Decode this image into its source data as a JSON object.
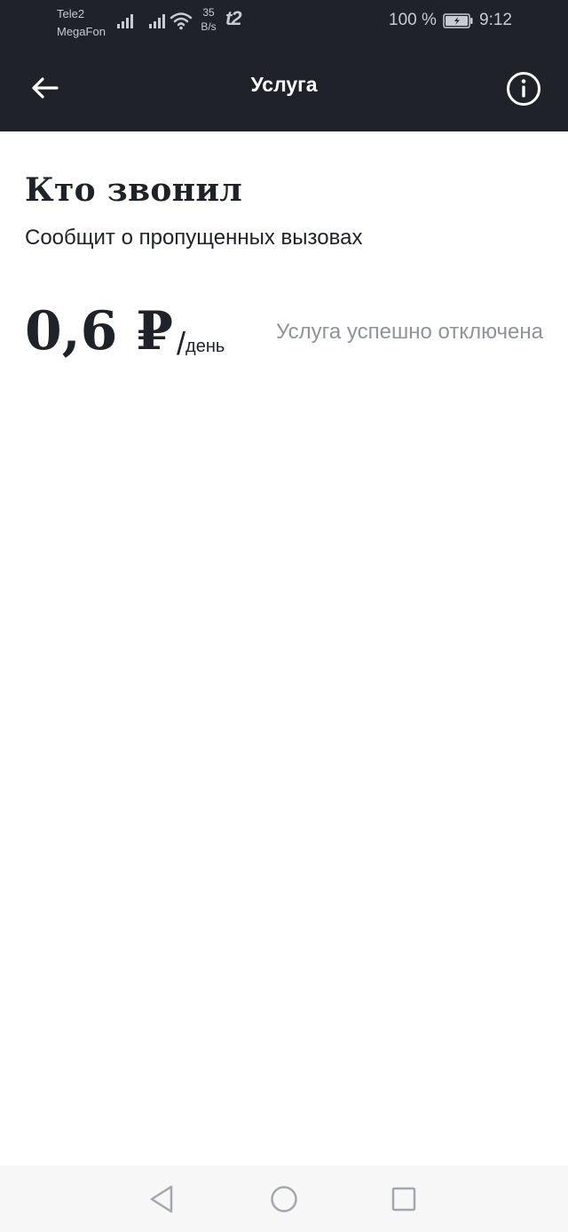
{
  "status_bar": {
    "carrier1": "Tele2",
    "carrier2": "MegaFon",
    "speed_value": "35",
    "speed_unit": "B/s",
    "operator_logo": "t2",
    "battery_percent": "100 %",
    "time": "9:12",
    "icons": [
      "signal-icon",
      "signal-icon",
      "wifi-icon",
      "battery-charging-icon"
    ]
  },
  "toolbar": {
    "title": "Услуга",
    "back_icon": "arrow-left-icon",
    "info_icon": "info-circle-icon"
  },
  "service": {
    "name": "Кто звонил",
    "description": "Сообщит о пропущенных вызовах",
    "price": "0,6 ₽",
    "price_slash": "/",
    "price_period": "день",
    "status": "Услуга успешно отключена"
  },
  "navigation_bar": {
    "icons": [
      "nav-back-icon",
      "nav-home-icon",
      "nav-recent-icon"
    ]
  },
  "colors": {
    "header_bg": "#1f2229",
    "text_primary": "#1f2229",
    "text_muted": "#8f939a",
    "nav_bg": "#f7f7f7"
  }
}
